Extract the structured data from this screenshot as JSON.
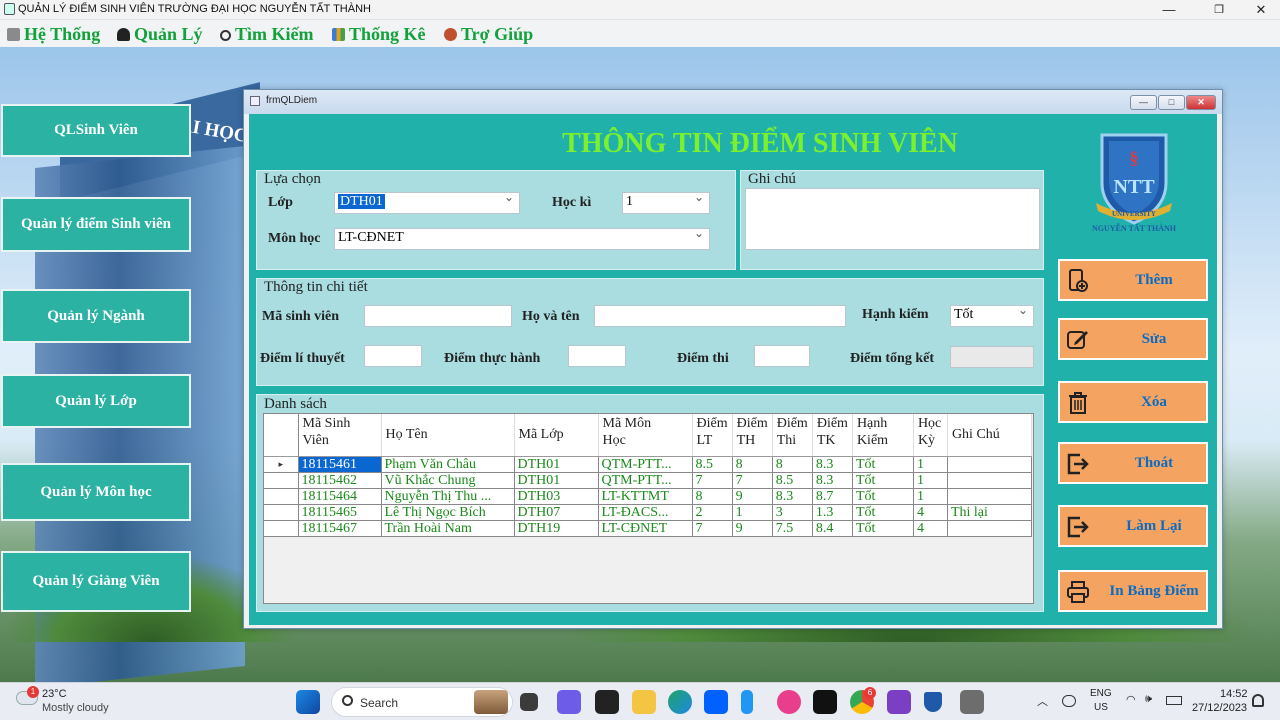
{
  "window_title": "QUẢN LÝ ĐIỂM SINH VIÊN TRƯỜNG ĐẠI HỌC NGUYỄN TẤT THÀNH",
  "menu": [
    {
      "label": "Hệ Thống",
      "icon": "system-icon",
      "color": "#7a7a7a"
    },
    {
      "label": "Quản Lý",
      "icon": "user-icon",
      "color": "#222222"
    },
    {
      "label": "Tìm Kiếm",
      "icon": "search-icon",
      "color": "#333333"
    },
    {
      "label": "Thống Kê",
      "icon": "chart-icon",
      "color": "#e0a020"
    },
    {
      "label": "Trợ Giúp",
      "icon": "help-icon",
      "color": "#c05030"
    }
  ],
  "background_sign": "ĐẠI HỌC",
  "nav": [
    "QLSinh Viên",
    "Quản lý điểm Sinh viên",
    "Quản lý Ngành",
    "Quản lý Lớp",
    "Quản lý Môn học",
    "Quản lý Giảng Viên"
  ],
  "form": {
    "title": "frmQLDiem",
    "heading": "THÔNG TIN ĐIỂM SINH VIÊN",
    "selection": {
      "group_label": "Lựa chọn",
      "class_label": "Lớp",
      "class_value": "DTH01",
      "semester_label": "Học kì",
      "semester_value": "1",
      "subject_label": "Môn học",
      "subject_value": "LT-CĐNET"
    },
    "note": {
      "group_label": "Ghi chú",
      "value": ""
    },
    "detail": {
      "group_label": "Thông tin chi tiết",
      "student_id_label": "Mã sinh viên",
      "student_id_value": "",
      "fullname_label": "Họ và tên",
      "fullname_value": "",
      "conduct_label": "Hạnh kiểm",
      "conduct_value": "Tốt",
      "theory_label": "Điểm lí thuyết",
      "theory_value": "",
      "practice_label": "Điểm thực hành",
      "practice_value": "",
      "exam_label": "Điểm thi",
      "exam_value": "",
      "total_label": "Điểm tổng kết",
      "total_value": ""
    },
    "list": {
      "group_label": "Danh sách",
      "columns": [
        [
          "Mã Sinh",
          "Viên"
        ],
        [
          "Họ Tên",
          ""
        ],
        [
          "Mã Lớp",
          ""
        ],
        [
          "Mã Môn",
          "Học"
        ],
        [
          "Điểm",
          "LT"
        ],
        [
          "Điểm",
          "TH"
        ],
        [
          "Điểm",
          "Thi"
        ],
        [
          "Điểm",
          "TK"
        ],
        [
          "Hạnh",
          "Kiểm"
        ],
        [
          "Học",
          "Kỳ"
        ],
        [
          "Ghi Chú",
          ""
        ]
      ],
      "current_row_marker": "▸",
      "rows": [
        [
          "18115461",
          "Phạm Văn Châu",
          "DTH01",
          "QTM-PTT...",
          "8.5",
          "8",
          "8",
          "8.3",
          "Tốt",
          "1",
          ""
        ],
        [
          "18115462",
          "Vũ Khắc Chung",
          "DTH01",
          "QTM-PTT...",
          "7",
          "7",
          "8.5",
          "8.3",
          "Tốt",
          "1",
          ""
        ],
        [
          "18115464",
          "Nguyễn Thị Thu ...",
          "DTH03",
          "LT-KTTMT",
          "8",
          "9",
          "8.3",
          "8.7",
          "Tốt",
          "1",
          ""
        ],
        [
          "18115465",
          "Lê Thị Ngọc Bích",
          "DTH07",
          "LT-ĐACS...",
          "2",
          "1",
          "3",
          "1.3",
          "Tốt",
          "4",
          "Thi lại"
        ],
        [
          "18115467",
          "Trần Hoài Nam",
          "DTH19",
          "LT-CĐNET",
          "7",
          "9",
          "7.5",
          "8.4",
          "Tốt",
          "4",
          ""
        ]
      ]
    },
    "actions": [
      {
        "label": "Thêm",
        "icon": "add-phone-icon"
      },
      {
        "label": "Sửa",
        "icon": "edit-icon"
      },
      {
        "label": "Xóa",
        "icon": "trash-icon"
      },
      {
        "label": "Thoát",
        "icon": "exit-icon"
      },
      {
        "label": "Làm Lại",
        "icon": "refresh-icon"
      },
      {
        "label": "In Bảng Điểm",
        "icon": "printer-icon"
      }
    ],
    "logo": {
      "initials": "NTT",
      "ribbon": "UNIVERSITY",
      "caption": "NGUYỄN TẤT THÀNH"
    }
  },
  "taskbar": {
    "weather_temp": "23°C",
    "weather_desc": "Mostly cloudy",
    "weather_badge": "1",
    "search_placeholder": "Search",
    "lang_top": "ENG",
    "lang_bottom": "US",
    "time": "14:52",
    "date": "27/12/2023",
    "chrome_badge": "6"
  },
  "colors": {
    "accent": "#20b2aa",
    "title_green": "#7cf02a",
    "menu_green": "#12a13b",
    "button_orange": "#f4a460",
    "button_text": "#0b6bc2",
    "selection_blue": "#0a67d1"
  }
}
